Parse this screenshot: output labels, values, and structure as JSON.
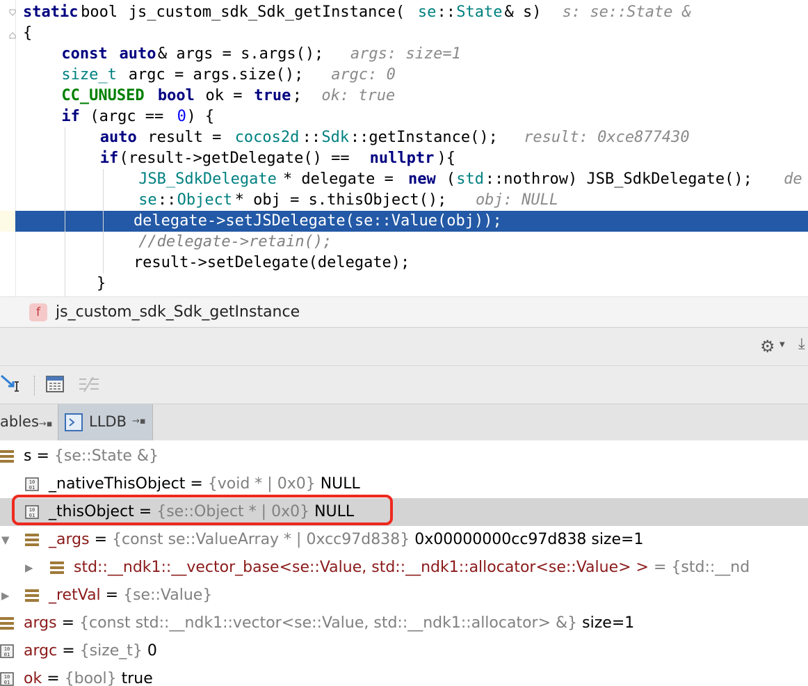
{
  "editor": {
    "lines": [
      {
        "tokens": [
          [
            "kw",
            "static"
          ],
          [
            "",
            "bool"
          ],
          [
            "",
            " js_custom_sdk_Sdk_getInstance("
          ],
          [
            "ty",
            "se"
          ],
          [
            "",
            "::"
          ],
          [
            "ty",
            "State"
          ],
          [
            "",
            "& s)  "
          ],
          [
            "inl",
            "s: se::State &"
          ]
        ]
      },
      {
        "tokens": [
          [
            "",
            "{"
          ]
        ]
      },
      {
        "tokens": [
          [
            "",
            "    "
          ],
          [
            "kw",
            "const"
          ],
          [
            "",
            " "
          ],
          [
            "kw",
            "auto"
          ],
          [
            "",
            "& args = s.args();  "
          ],
          [
            "inl",
            "args: size=1"
          ]
        ]
      },
      {
        "tokens": [
          [
            "",
            "    "
          ],
          [
            "ty",
            "size_t"
          ],
          [
            "",
            " argc = args.size();  "
          ],
          [
            "inl",
            "argc: 0"
          ]
        ]
      },
      {
        "tokens": [
          [
            "",
            "    "
          ],
          [
            "mac",
            "CC_UNUSED"
          ],
          [
            "",
            " "
          ],
          [
            "kw",
            "bool"
          ],
          [
            "",
            " ok = "
          ],
          [
            "kw",
            "true"
          ],
          [
            "",
            ";  "
          ],
          [
            "inl",
            "ok: true"
          ]
        ]
      },
      {
        "tokens": [
          [
            "",
            "    "
          ],
          [
            "kw",
            "if"
          ],
          [
            "",
            " (argc == "
          ],
          [
            "num",
            "0"
          ],
          [
            "",
            ") {"
          ]
        ]
      },
      {
        "tokens": [
          [
            "",
            "        "
          ],
          [
            "kw",
            "auto"
          ],
          [
            "",
            " result = "
          ],
          [
            "ty",
            "cocos2d"
          ],
          [
            "",
            "::"
          ],
          [
            "ty",
            "Sdk"
          ],
          [
            "",
            "::getInstance();  "
          ],
          [
            "inl",
            "result: 0xce877430"
          ]
        ]
      },
      {
        "tokens": [
          [
            "",
            "        "
          ],
          [
            "kw",
            "if"
          ],
          [
            "",
            "(result->getDelegate() == "
          ],
          [
            "kw",
            "nullptr"
          ],
          [
            "",
            "){"
          ]
        ]
      },
      {
        "tokens": [
          [
            "",
            "            "
          ],
          [
            "ty",
            "JSB_SdkDelegate"
          ],
          [
            "",
            "* delegate = "
          ],
          [
            "kw",
            "new"
          ],
          [
            "",
            " ("
          ],
          [
            "ty",
            "std"
          ],
          [
            "",
            "::nothrow) JSB_SdkDelegate();  "
          ],
          [
            "inl",
            "de"
          ]
        ]
      },
      {
        "tokens": [
          [
            "",
            "            "
          ],
          [
            "ty",
            "se"
          ],
          [
            "",
            "::"
          ],
          [
            "ty",
            "Object"
          ],
          [
            "",
            "* obj = s.thisObject();  "
          ],
          [
            "inl",
            "obj: NULL"
          ]
        ]
      },
      {
        "tokens": [
          [
            "wht",
            "            delegate->setJSDelegate(se::Value(obj));"
          ]
        ]
      },
      {
        "tokens": [
          [
            "",
            "            "
          ],
          [
            "cmt",
            "//delegate->retain();"
          ]
        ]
      },
      {
        "tokens": [
          [
            "",
            "            result->setDelegate(delegate);"
          ]
        ]
      },
      {
        "tokens": [
          [
            "",
            "        }"
          ]
        ]
      }
    ]
  },
  "breadcrumb": {
    "badge": "f",
    "function": "js_custom_sdk_Sdk_getInstance"
  },
  "tabs": {
    "variables_label": "ables",
    "lldb_label": "LLDB",
    "pin": "→▪"
  },
  "variables": [
    {
      "expand": "",
      "icon": "struct",
      "name": "s",
      "name_color": "black",
      "type": "{se::State &}",
      "value": ""
    },
    {
      "expand": "",
      "icon": "binary",
      "name": "_nativeThisObject",
      "name_color": "black",
      "type": "{void * | 0x0}",
      "value": "NULL"
    },
    {
      "expand": "",
      "icon": "binary",
      "name": "_thisObject",
      "name_color": "black",
      "type": "{se::Object * | 0x0}",
      "value": "NULL",
      "selected": true
    },
    {
      "expand": "▼",
      "icon": "struct",
      "name": "_args",
      "name_color": "red",
      "type": "{const se::ValueArray * | 0xcc97d838}",
      "value": "0x00000000cc97d838 size=1"
    },
    {
      "expand": "▶",
      "icon": "struct",
      "name": "std::__ndk1::__vector_base<se::Value, std::__ndk1::allocator<se::Value> >",
      "name_color": "red",
      "type": "= {std::__nd",
      "value": ""
    },
    {
      "expand": "▶",
      "icon": "struct",
      "name": "_retVal",
      "name_color": "red",
      "type": "{se::Value}",
      "value": ""
    },
    {
      "expand": "",
      "icon": "struct",
      "name": "args",
      "name_color": "red",
      "type": "{const std::__ndk1::vector<se::Value, std::__ndk1::allocator> &}",
      "value": "size=1"
    },
    {
      "expand": "",
      "icon": "binary",
      "name": "argc",
      "name_color": "red",
      "type": "{size_t}",
      "value": "0"
    },
    {
      "expand": "",
      "icon": "binary",
      "name": "ok",
      "name_color": "red",
      "type": "{bool}",
      "value": "true"
    }
  ],
  "icons": {
    "settings": "gear-icon",
    "download": "download-icon",
    "step": "step-into-icon",
    "table": "table-icon",
    "frames": "frames-icon"
  },
  "colors": {
    "highlight": "#2359a6",
    "selection_box": "#ee2a1f",
    "keyword": "#000080",
    "type": "#008080"
  }
}
